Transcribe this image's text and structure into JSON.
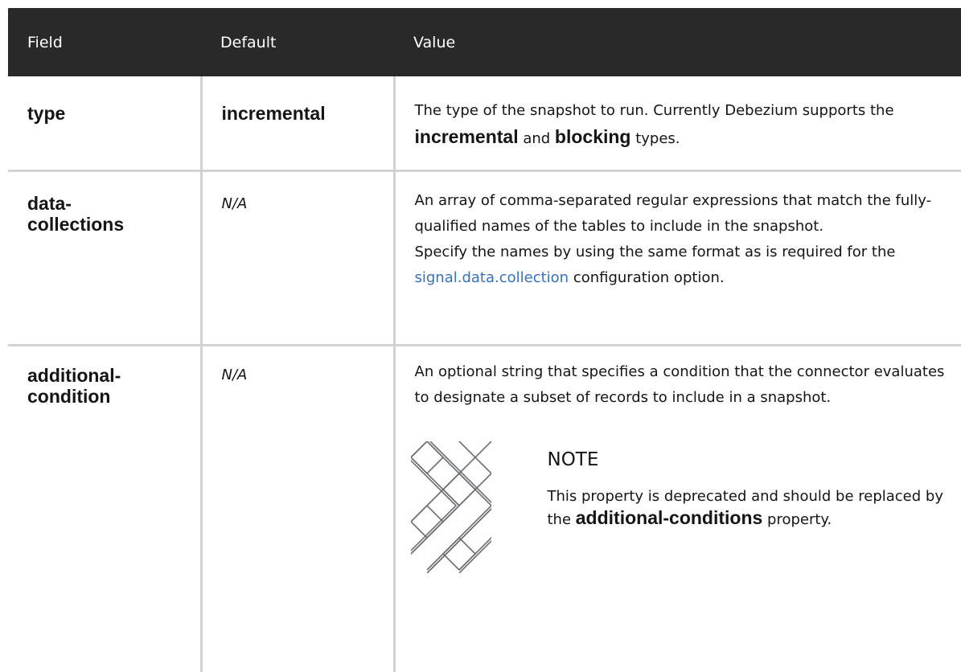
{
  "headers": {
    "field": "Field",
    "default": "Default",
    "value": "Value"
  },
  "rows": [
    {
      "field": "type",
      "default": "incremental",
      "value_parts": {
        "t1": "The type of the snapshot to run. Currently Debezium supports the ",
        "b1": "incremental",
        "t2": " and ",
        "b2": "blocking",
        "t3": " types."
      }
    },
    {
      "field_line1": "data-",
      "field_line2": "collections",
      "default": "N/A",
      "value_p1": "An array of comma-separated regular expressions that match the fully-qualified names of the tables to include in the snapshot.",
      "value_p2_a": "Specify the names by using the same format as is required for the ",
      "value_p2_link": "signal.data.collection",
      "value_p2_b": " configuration option."
    },
    {
      "field_line1": "additional-",
      "field_line2": "condition",
      "default": "N/A",
      "value_p1": "An optional string that specifies a condition that the connector evaluates to designate a subset of records to include in a snapshot.",
      "note": {
        "title": "NOTE",
        "text_a": "This property is deprecated and should be replaced by the ",
        "bold": "additional-conditions",
        "text_b": " property.",
        "icon": "note-pattern-icon"
      }
    }
  ],
  "colors": {
    "header_bg": "#292929",
    "link": "#3570c2",
    "border": "#d2d2d2"
  }
}
